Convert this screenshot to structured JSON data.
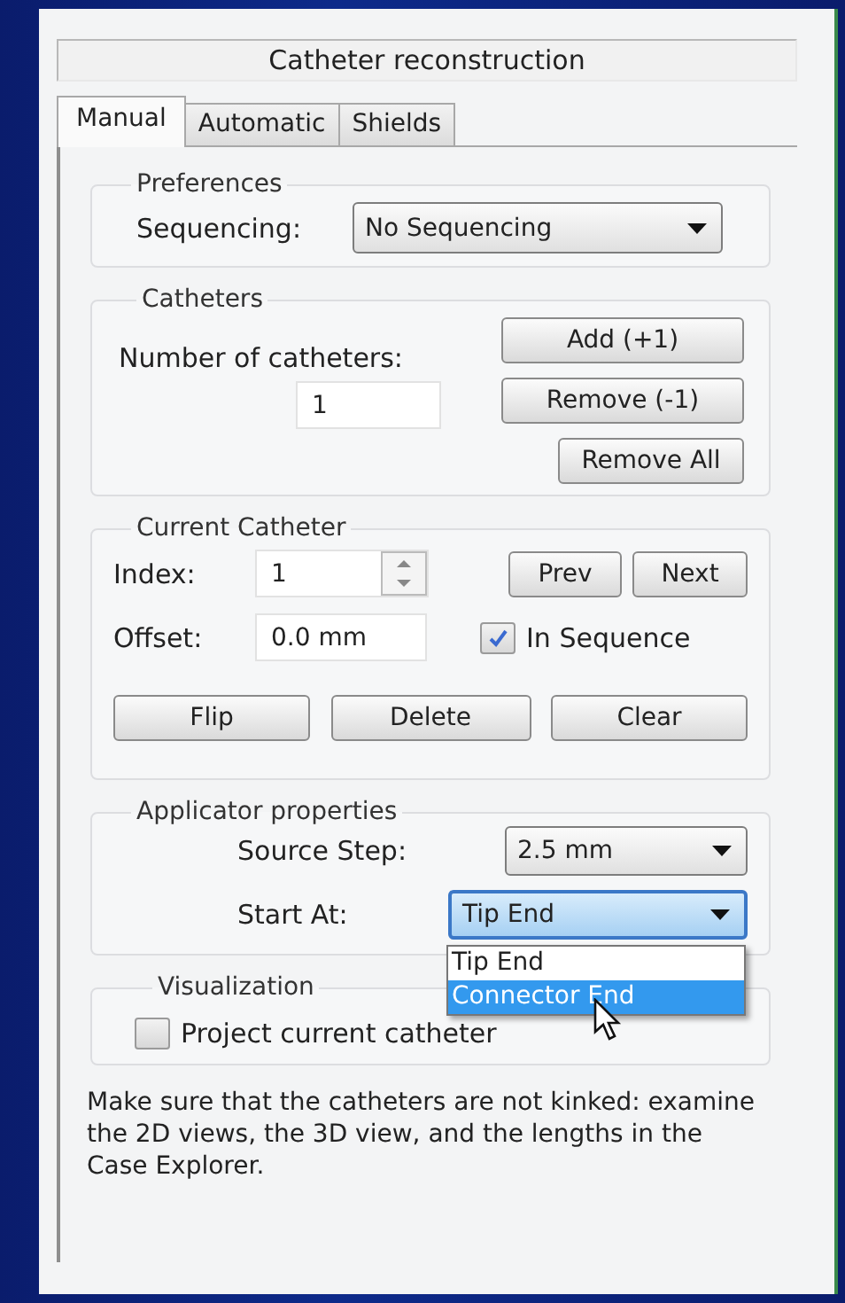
{
  "title": "Catheter reconstruction",
  "tabs": [
    {
      "label": "Manual",
      "selected": true
    },
    {
      "label": "Automatic",
      "selected": false
    },
    {
      "label": "Shields",
      "selected": false
    }
  ],
  "preferences": {
    "title": "Preferences",
    "sequencing_label": "Sequencing:",
    "sequencing_value": "No Sequencing"
  },
  "catheters": {
    "title": "Catheters",
    "count_label": "Number of catheters:",
    "count_value": "1",
    "buttons": [
      "Add (+1)",
      "Remove (-1)",
      "Remove All"
    ]
  },
  "current_catheter": {
    "title": "Current Catheter",
    "index_label": "Index:",
    "index_value": "1",
    "offset_label": "Offset:",
    "offset_value": "0.0 mm",
    "nav_buttons": [
      "Prev",
      "Next"
    ],
    "in_sequence": {
      "label": "In Sequence",
      "checked": true
    },
    "action_buttons": [
      "Flip",
      "Delete",
      "Clear"
    ]
  },
  "applicator": {
    "title": "Applicator properties",
    "source_step_label": "Source Step:",
    "source_step_value": "2.5 mm",
    "start_at_label": "Start At:",
    "start_at_value": "Tip End",
    "start_at_open": true,
    "start_at_options": [
      {
        "label": "Tip End",
        "selected": false
      },
      {
        "label": "Connector End",
        "selected": true
      }
    ]
  },
  "visualization": {
    "title": "Visualization",
    "project": {
      "label": "Project current catheter",
      "checked": false
    }
  },
  "note": "Make sure that the catheters are not kinked: examine the 2D views, the 3D view, and the lengths in the Case Explorer."
}
